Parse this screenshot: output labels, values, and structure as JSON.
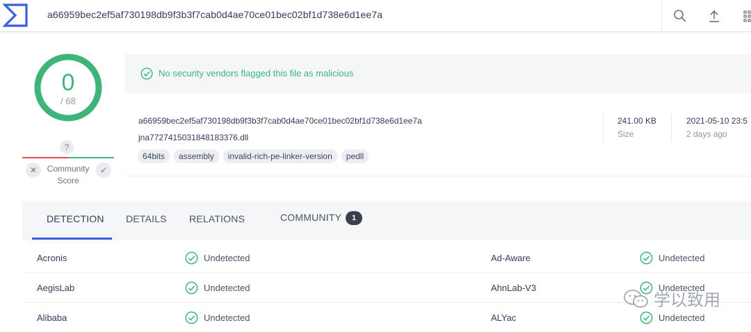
{
  "topbar": {
    "search_value": "a66959bec2ef5af730198db9f3b3f7cab0d4ae70ce01bec02bf1d738e6d1ee7a",
    "icons": [
      "logo-icon",
      "search-icon",
      "upload-icon",
      "grid-icon"
    ]
  },
  "score": {
    "detections": "0",
    "total": "/ 68",
    "unknown_mark": "?",
    "community_label": "Community Score",
    "vote_down": "✕",
    "vote_up": "✓"
  },
  "banner": {
    "text": "No security vendors flagged this file as malicious"
  },
  "file": {
    "hash": "a66959bec2ef5af730198db9f3b3f7cab0d4ae70ce01bec02bf1d738e6d1ee7a",
    "name": "jna7727415031848183376.dll",
    "tags": [
      "64bits",
      "assembly",
      "invalid-rich-pe-linker-version",
      "pedll"
    ],
    "size_value": "241.00 KB",
    "size_label": "Size",
    "date_value": "2021-05-10 23:5",
    "date_label": "2 days ago"
  },
  "tabs": {
    "detection": "DETECTION",
    "details": "DETAILS",
    "relations": "RELATIONS",
    "community": "COMMUNITY",
    "community_count": "1"
  },
  "results": [
    {
      "left_vendor": "Acronis",
      "left_result": "Undetected",
      "right_vendor": "Ad-Aware",
      "right_result": "Undetected"
    },
    {
      "left_vendor": "AegisLab",
      "left_result": "Undetected",
      "right_vendor": "AhnLab-V3",
      "right_result": "Undetected"
    },
    {
      "left_vendor": "Alibaba",
      "left_result": "Undetected",
      "right_vendor": "ALYac",
      "right_result": "Undetected"
    }
  ],
  "watermark": {
    "text": "学以致用"
  },
  "colors": {
    "accent": "#3b5ce6",
    "clean": "#3fb47a",
    "malicious": "#e5484d"
  }
}
